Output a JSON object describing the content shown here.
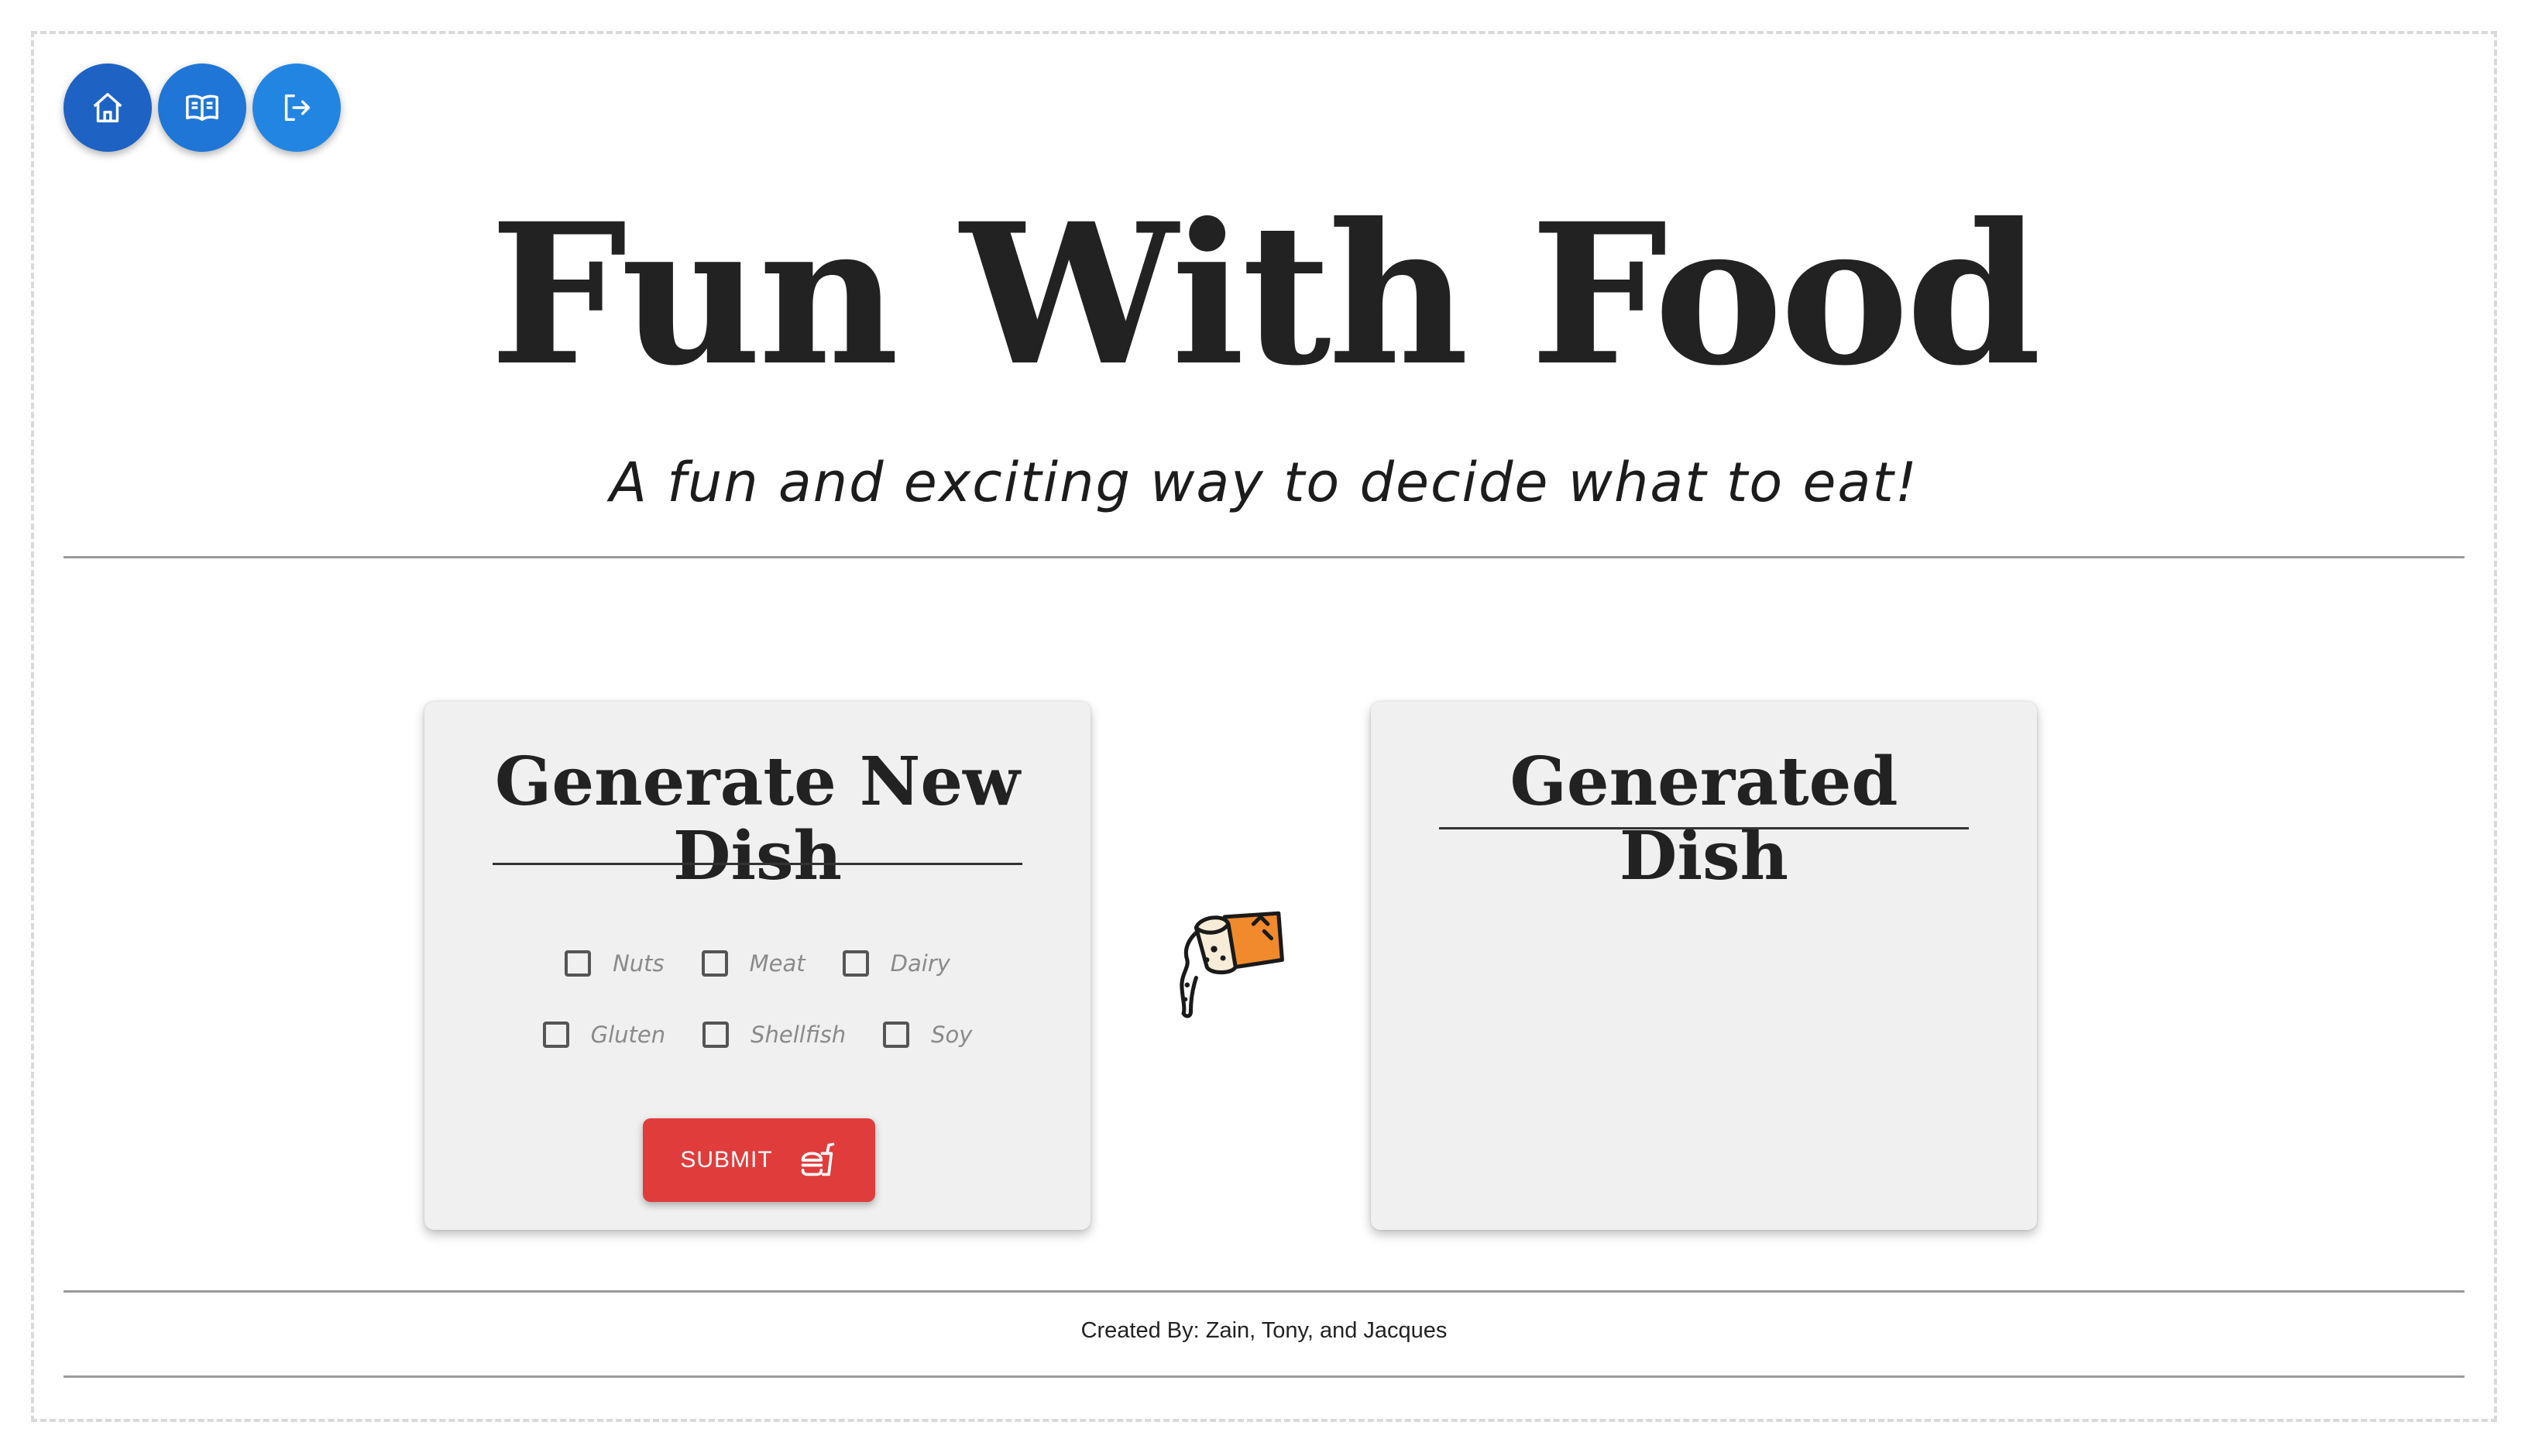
{
  "nav": {
    "buttons": [
      {
        "icon": "home-icon",
        "color": "#1e62c4"
      },
      {
        "icon": "book-icon",
        "color": "#1f76d6"
      },
      {
        "icon": "logout-icon",
        "color": "#2385e2"
      }
    ]
  },
  "header": {
    "title": "Fun With Food",
    "subtitle": "A fun and exciting way to decide what to eat!"
  },
  "generator": {
    "title": "Generate New Dish",
    "allergens": [
      {
        "label": "Nuts",
        "checked": false
      },
      {
        "label": "Meat",
        "checked": false
      },
      {
        "label": "Dairy",
        "checked": false
      },
      {
        "label": "Gluten",
        "checked": false
      },
      {
        "label": "Shellfish",
        "checked": false
      },
      {
        "label": "Soy",
        "checked": false
      }
    ],
    "submit_label": "SUBMIT",
    "submit_icon": "fastfood-icon",
    "submit_color": "#e03c3c"
  },
  "decor": {
    "icon": "pouring-sauce-icon"
  },
  "result": {
    "title": "Generated Dish"
  },
  "footer": {
    "credits": "Created By: Zain, Tony, and Jacques"
  }
}
